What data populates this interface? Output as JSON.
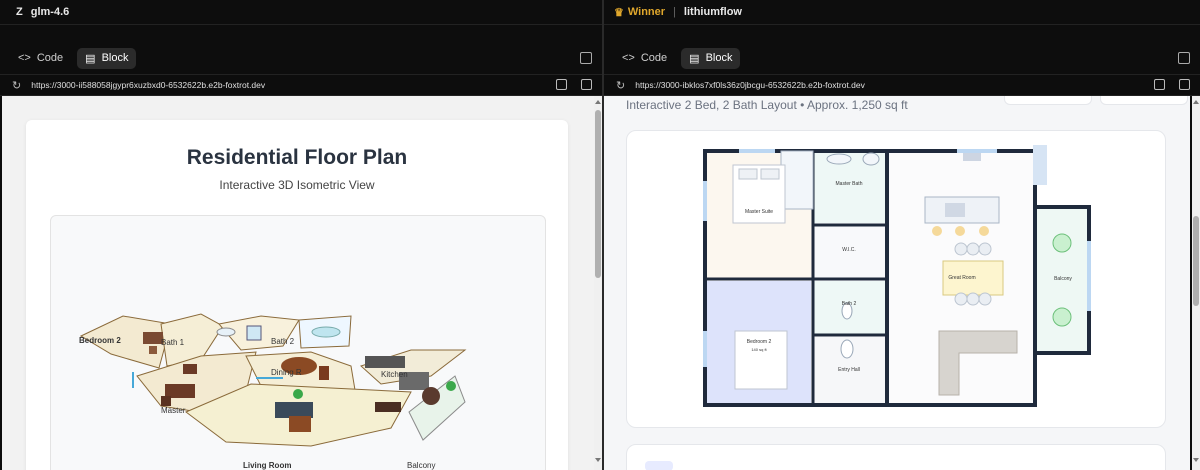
{
  "left": {
    "header": {
      "logo": "Z",
      "model": "glm-4.6"
    },
    "tabs": [
      {
        "label": "Code",
        "active": false
      },
      {
        "label": "Block",
        "active": true
      }
    ],
    "url": "https://3000-ii588058jgypr6xuzbxd0-6532622b.e2b-foxtrot.dev",
    "page": {
      "title": "Residential Floor Plan",
      "subtitle": "Interactive 3D Isometric View",
      "rooms": {
        "bedroom2": "Bedroom 2",
        "bath1": "Bath 1",
        "bath2": "Bath 2",
        "dining": "Dining R",
        "kitchen": "Kitchen",
        "master": "Master",
        "living": "Living Room",
        "balcony": "Balcony"
      }
    }
  },
  "right": {
    "header": {
      "winner_icon": "crown-icon",
      "winner": "Winner",
      "sep": "|",
      "model": "lithiumflow"
    },
    "tabs": [
      {
        "label": "Code",
        "active": false
      },
      {
        "label": "Block",
        "active": true
      }
    ],
    "url": "https://3000-ibklos7xf0ls36z0jbcgu-6532622b.e2b-foxtrot.dev",
    "page": {
      "subtitle": "Interactive 2 Bed, 2 Bath Layout • Approx. 1,250 sq ft",
      "rooms": {
        "master_suite": "Master Suite",
        "master_bath": "Master Bath",
        "wic": "W.I.C.",
        "bath2": "Bath 2",
        "bedroom2": "Bedroom 2",
        "bedroom2_area": "140 sq ft",
        "entry_hall": "Entry Hall",
        "great_room": "Great Room",
        "balcony": "Balcony"
      }
    }
  },
  "colors": {
    "winner": "#e0a72c",
    "chrome_bg": "#0d0d0d",
    "wall": "#1f2a3c",
    "bedroom2_fill": "#dde3fb"
  }
}
